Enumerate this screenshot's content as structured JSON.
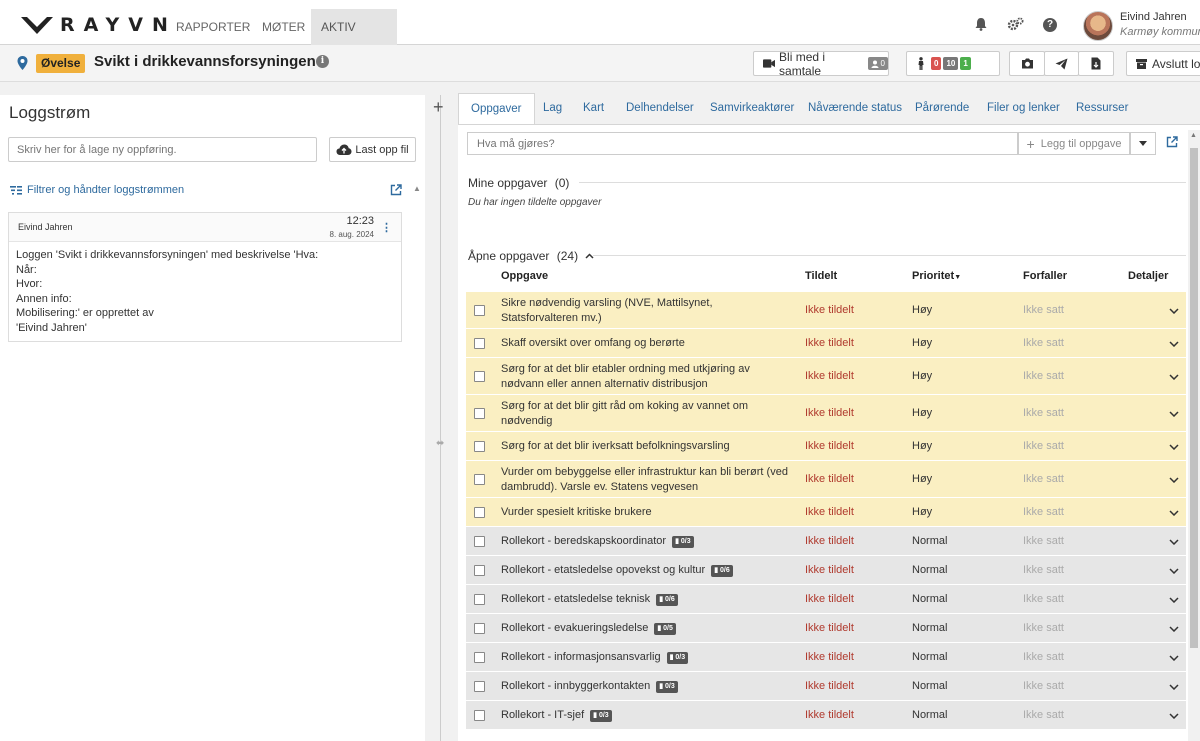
{
  "nav": {
    "brand": "RAYVN",
    "items": [
      {
        "label": "RAPPORTER"
      },
      {
        "label": "MØTER"
      },
      {
        "label": "AKTIV LOGG"
      }
    ],
    "user": {
      "name": "Eivind Jahren",
      "org": "Karmøy kommune"
    },
    "icons": [
      "bell-icon",
      "gears-icon",
      "help-icon"
    ]
  },
  "titlebar": {
    "badge": "Øvelse",
    "title": "Svikt i drikkevannsforsyningen",
    "join_call": "Bli med i samtale",
    "call_count": "0",
    "status_counts": {
      "red": "0",
      "gray": "10",
      "green": "1"
    },
    "end_log": "Avslutt logg"
  },
  "left": {
    "title": "Loggstrøm",
    "input_placeholder": "Skriv her for å lage ny oppføring.",
    "upload": "Last opp fil",
    "filter": "Filtrer og håndter loggstrømmen",
    "entry": {
      "author": "Eivind Jahren",
      "time": "12:23",
      "date": "8. aug. 2024",
      "lines": [
        "Loggen 'Svikt i drikkevannsforsyningen' med beskrivelse 'Hva:",
        "Når:",
        "Hvor:",
        "Annen info:",
        "Mobilisering:' er opprettet av",
        "'Eivind Jahren'"
      ]
    }
  },
  "tabs": [
    {
      "label": "Oppgaver"
    },
    {
      "label": "Lag"
    },
    {
      "label": "Kart"
    },
    {
      "label": "Delhendelser"
    },
    {
      "label": "Samvirkeaktører"
    },
    {
      "label": "Nåværende status"
    },
    {
      "label": "Pårørende"
    },
    {
      "label": "Filer og lenker"
    },
    {
      "label": "Ressurser"
    }
  ],
  "tasks": {
    "input_placeholder": "Hva må gjøres?",
    "add_button": "Legg til oppgave",
    "my_tasks_title": "Mine oppgaver",
    "my_tasks_count": "(0)",
    "my_tasks_empty": "Du har ingen tildelte oppgaver",
    "open_tasks_title": "Åpne oppgaver",
    "open_tasks_count": "(24)",
    "columns": {
      "task": "Oppgave",
      "assigned": "Tildelt",
      "priority": "Prioritet",
      "due": "Forfaller",
      "details": "Detaljer"
    },
    "rows": [
      {
        "text": "Sikre nødvendig varsling (NVE, Mattilsynet, Statsforvalteren mv.)",
        "badge": "",
        "assigned": "Ikke tildelt",
        "priority": "Høy",
        "due": "Ikke satt"
      },
      {
        "text": "Skaff oversikt over omfang og berørte",
        "badge": "",
        "assigned": "Ikke tildelt",
        "priority": "Høy",
        "due": "Ikke satt"
      },
      {
        "text": "Sørg for at det blir etabler ordning med utkjøring av nødvann eller annen alternativ distribusjon",
        "badge": "",
        "assigned": "Ikke tildelt",
        "priority": "Høy",
        "due": "Ikke satt"
      },
      {
        "text": "Sørg for at det blir gitt råd om koking av vannet om nødvendig",
        "badge": "",
        "assigned": "Ikke tildelt",
        "priority": "Høy",
        "due": "Ikke satt"
      },
      {
        "text": "Sørg for at det blir iverksatt befolkningsvarsling",
        "badge": "",
        "assigned": "Ikke tildelt",
        "priority": "Høy",
        "due": "Ikke satt"
      },
      {
        "text": "Vurder om bebyggelse eller infrastruktur kan bli berørt (ved dambrudd). Varsle ev. Statens vegvesen",
        "badge": "",
        "assigned": "Ikke tildelt",
        "priority": "Høy",
        "due": "Ikke satt"
      },
      {
        "text": "Vurder spesielt kritiske brukere",
        "badge": "",
        "assigned": "Ikke tildelt",
        "priority": "Høy",
        "due": "Ikke satt"
      },
      {
        "text": "Rollekort - beredskapskoordinator",
        "badge": "0/3",
        "assigned": "Ikke tildelt",
        "priority": "Normal",
        "due": "Ikke satt"
      },
      {
        "text": "Rollekort - etatsledelse opovekst og kultur",
        "badge": "0/6",
        "assigned": "Ikke tildelt",
        "priority": "Normal",
        "due": "Ikke satt"
      },
      {
        "text": "Rollekort - etatsledelse teknisk",
        "badge": "0/6",
        "assigned": "Ikke tildelt",
        "priority": "Normal",
        "due": "Ikke satt"
      },
      {
        "text": "Rollekort - evakueringsledelse",
        "badge": "0/5",
        "assigned": "Ikke tildelt",
        "priority": "Normal",
        "due": "Ikke satt"
      },
      {
        "text": "Rollekort - informasjonsansvarlig",
        "badge": "0/3",
        "assigned": "Ikke tildelt",
        "priority": "Normal",
        "due": "Ikke satt"
      },
      {
        "text": "Rollekort - innbyggerkontakten",
        "badge": "0/3",
        "assigned": "Ikke tildelt",
        "priority": "Normal",
        "due": "Ikke satt"
      },
      {
        "text": "Rollekort - IT-sjef",
        "badge": "0/3",
        "assigned": "Ikke tildelt",
        "priority": "Normal",
        "due": "Ikke satt"
      }
    ]
  },
  "colors": {
    "accent": "#2e6a9e",
    "badge": "#f0b03c",
    "high_row": "#faefc2",
    "normal_row": "#e6e6e6",
    "unassigned": "#b03a2e"
  }
}
